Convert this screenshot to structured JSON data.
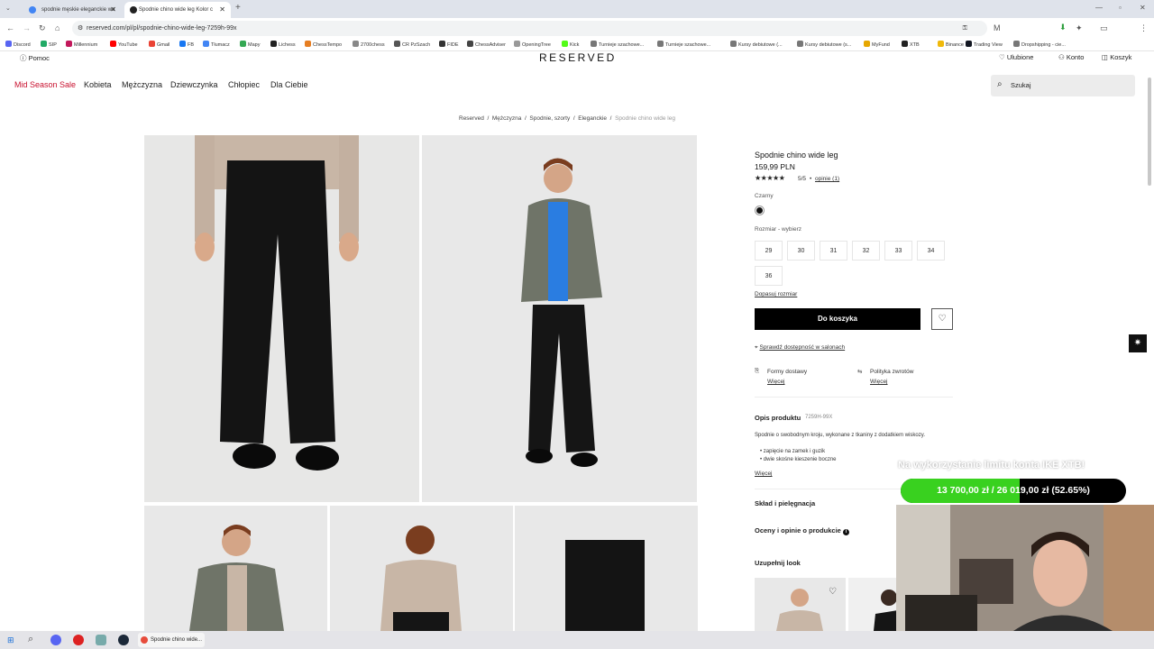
{
  "browser": {
    "tabs": [
      {
        "title": "spodnie męskie eleganckie wo"
      },
      {
        "title": "Spodnie chino wide leg Kolor c"
      }
    ],
    "new_tab": "+",
    "url": "reserved.com/pl/pl/spodnie-chino-wide-leg-7259h-99x",
    "bookmarks": [
      "Discord",
      "SIP",
      "Millennium",
      "YouTube",
      "Gmail",
      "FB",
      "Tłumacz",
      "Mapy",
      "Lichess",
      "ChessTempo",
      "2700chess",
      "CR PzSzach",
      "FIDE",
      "ChessAdviser",
      "OpeningTree",
      "Kick",
      "Turnieje szachowe...",
      "Turnieje szachowe...",
      "Kursy debiutowe (...",
      "Kursy debiutowe (s...",
      "MyFund",
      "XTB",
      "Binance",
      "Trading View",
      "Dropshipping - cie..."
    ]
  },
  "site": {
    "help": "Pomoc",
    "logo": "RESERVED",
    "favorites": "Ulubione",
    "account": "Konto",
    "cart": "Koszyk",
    "nav": [
      "Mid Season Sale",
      "Kobieta",
      "Mężczyzna",
      "Dziewczynka",
      "Chłopiec",
      "Dla Ciebie"
    ],
    "search_placeholder": "Szukaj",
    "breadcrumb": [
      "Reserved",
      "Mężczyzna",
      "Spodnie, szorty",
      "Eleganckie",
      "Spodnie chino wide leg"
    ]
  },
  "product": {
    "name": "Spodnie chino wide leg",
    "price": "159,99 PLN",
    "rating": "5/5",
    "reviews": "opinie (1)",
    "stars": 5,
    "color_label": "Czarny",
    "color_hex": "#111111",
    "size_label": "Rozmiar -  wybierz",
    "sizes": [
      "29",
      "30",
      "31",
      "32",
      "33",
      "34",
      "36"
    ],
    "fit_link": "Dopasuj rozmiar",
    "add_to_cart": "Do koszyka",
    "store_check": "Sprawdź dostępność w salonach",
    "delivery": "Formy dostawy",
    "delivery_more": "Więcej",
    "returns": "Polityka zwrotów",
    "returns_more": "Więcej",
    "desc_title": "Opis produktu",
    "sku": "7259H-99X",
    "desc": "Spodnie o swobodnym kroju, wykonane z tkaniny z dodatkiem wiskozy.",
    "bullets": [
      "zapięcie na zamek i guzik",
      "dwie skośne kieszenie boczne"
    ],
    "desc_more": "Więcej",
    "composition": "Skład i pielęgnacja",
    "ratings": "Oceny i opinie o produkcie",
    "complete_look": "Uzupełnij look"
  },
  "overlay": {
    "title": "Na wykorzystanie limitu konta IKE XTB!",
    "progress_text": "13 700,00 zł / 26 019,00 zł (52.65%)",
    "progress": 0.5265
  },
  "taskbar": {
    "active_window": "Spodnie chino wide..."
  },
  "colors": {
    "sale": "#c8102e",
    "button": "#000000",
    "progress": "#39d11f"
  }
}
